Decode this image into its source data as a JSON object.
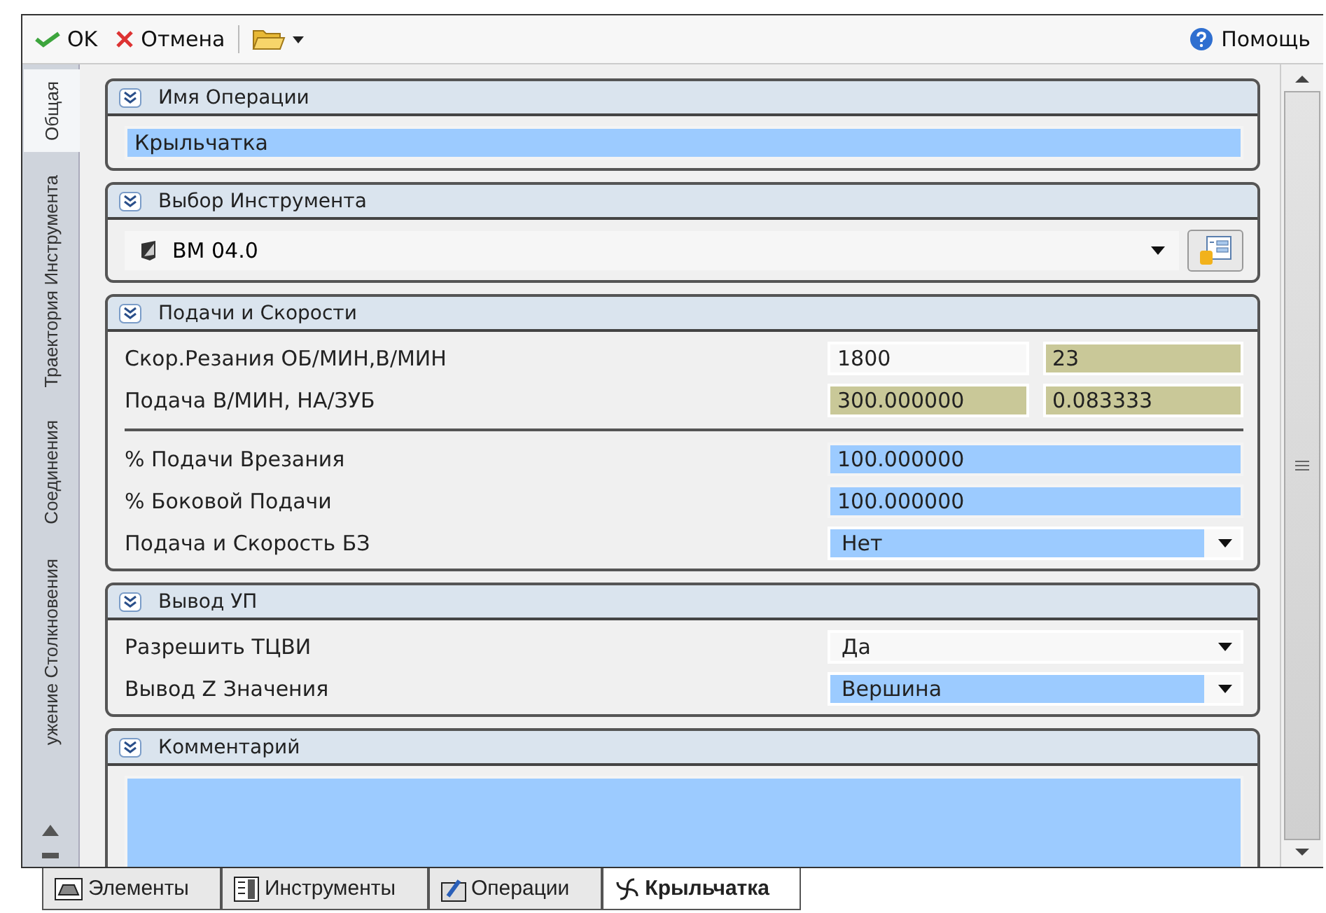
{
  "toolbar": {
    "ok": "OK",
    "cancel": "Отмена",
    "help": "Помощь"
  },
  "side_tabs": [
    {
      "label": "Общая",
      "selected": true
    },
    {
      "label": "Траектория Инструмента",
      "selected": false
    },
    {
      "label": "Соединения",
      "selected": false
    },
    {
      "label": "ужение Столкновения",
      "selected": false
    }
  ],
  "sections": [
    {
      "title": "Имя Операции",
      "kind": "name",
      "field": {
        "value": "Крыльчатка",
        "highlighted": true
      }
    },
    {
      "title": "Выбор Инструмента",
      "kind": "tool",
      "tool": "BM 04.0"
    },
    {
      "title": "Подачи и Скорости",
      "kind": "form",
      "rows": [
        {
          "kind": "pair",
          "label": "Скор.Резания ОБ/МИН,В/МИН",
          "fields": [
            {
              "value": "1800",
              "readonly": false
            },
            {
              "value": "23",
              "readonly": true
            }
          ]
        },
        {
          "kind": "pair",
          "label": "Подача В/МИН, НА/ЗУБ",
          "fields": [
            {
              "value": "300.000000",
              "readonly": true
            },
            {
              "value": "0.083333",
              "readonly": true
            }
          ]
        },
        {
          "kind": "divider"
        },
        {
          "kind": "single",
          "label": "% Подачи Врезания",
          "field": {
            "value": "100.000000",
            "highlighted": true
          }
        },
        {
          "kind": "single",
          "label": "% Боковой Подачи",
          "field": {
            "value": "100.000000",
            "highlighted": true
          }
        },
        {
          "kind": "dropdown",
          "label": "Подача и Скорость БЗ",
          "field": {
            "value": "Нет",
            "highlighted": true
          }
        }
      ]
    },
    {
      "title": "Вывод УП",
      "kind": "form",
      "rows": [
        {
          "kind": "dropdown",
          "label": "Разрешить ТЦВИ",
          "field": {
            "value": "Да",
            "highlighted": false
          }
        },
        {
          "kind": "dropdown",
          "label": "Вывод Z Значения",
          "field": {
            "value": "Вершина",
            "highlighted": true
          }
        }
      ]
    },
    {
      "title": "Комментарий",
      "kind": "comment",
      "field": {
        "highlighted": true
      }
    }
  ],
  "bottom_tabs": [
    {
      "label": "Элементы",
      "kind": "elements",
      "selected": false
    },
    {
      "label": "Инструменты",
      "kind": "tools",
      "selected": false
    },
    {
      "label": "Операции",
      "kind": "operations",
      "selected": false
    },
    {
      "label": "Крыльчатка",
      "kind": "impeller",
      "selected": true
    }
  ]
}
